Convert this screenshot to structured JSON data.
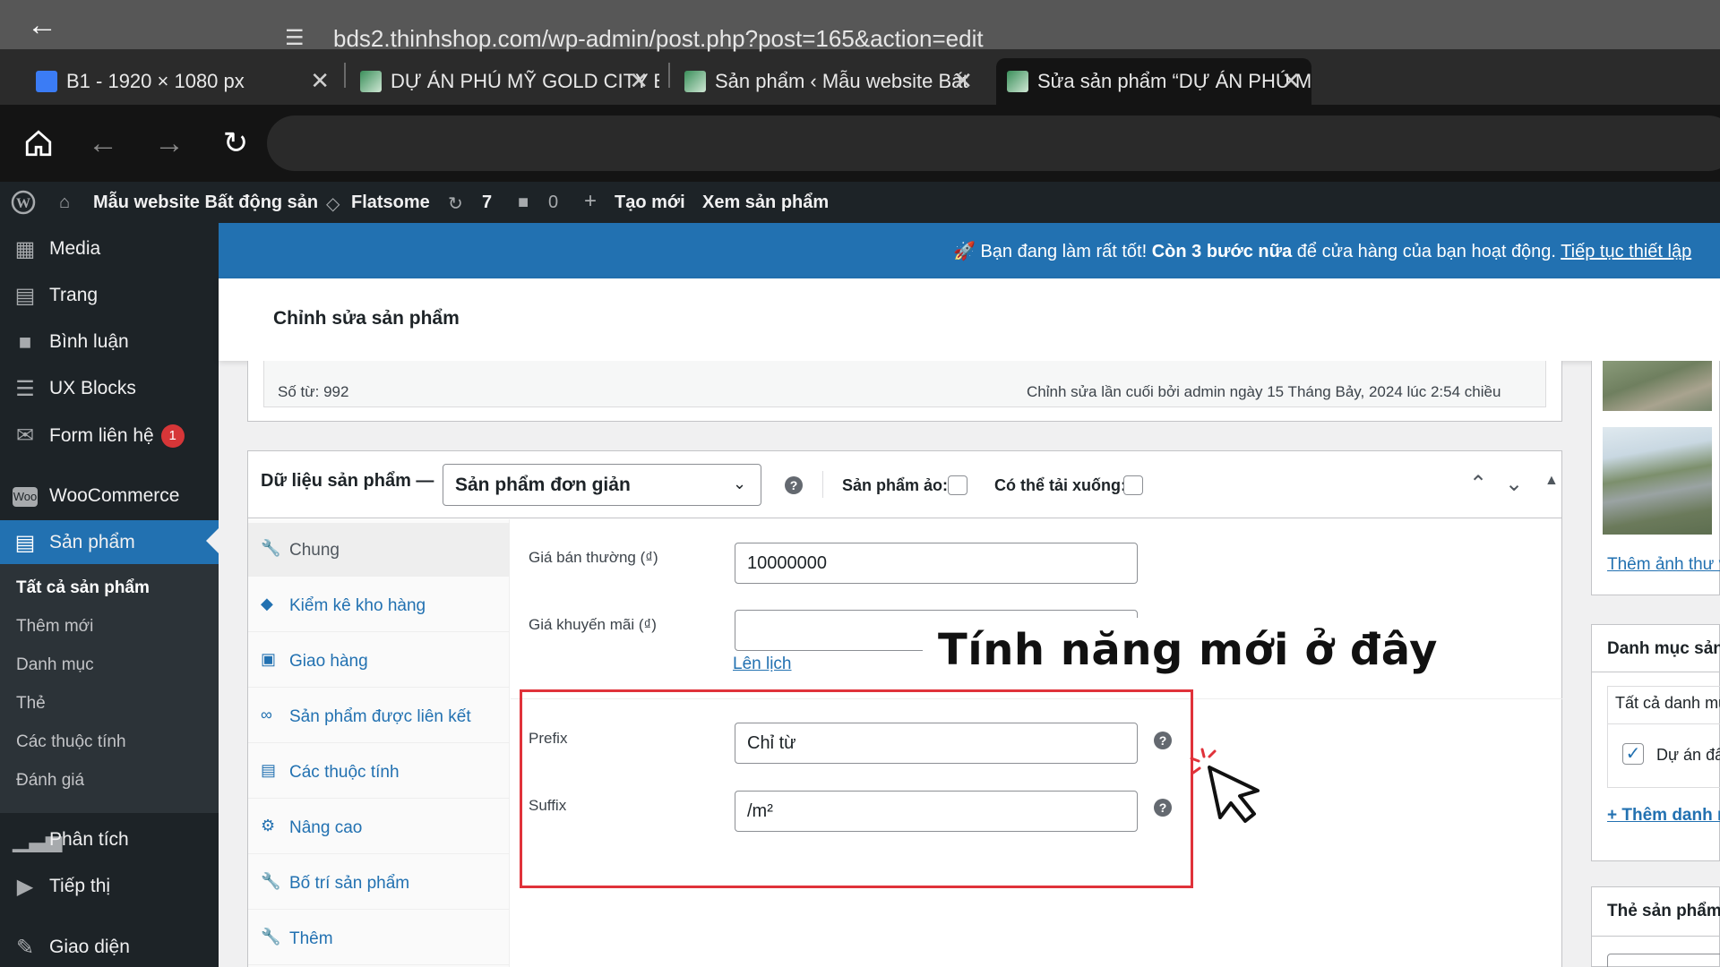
{
  "browser": {
    "tabs": [
      {
        "title": "B1 - 1920 × 1080 px",
        "favicon": "canva-icon",
        "color": "#3b7cf5"
      },
      {
        "title": "DỰ ÁN PHÚ MỸ GOLD CITY BÀ",
        "favicon": "site-icon",
        "color": "#3a8f5a"
      },
      {
        "title": "Sản phẩm ‹ Mẫu website Bất",
        "favicon": "site-icon",
        "color": "#3a8f5a"
      },
      {
        "title": "Sửa sản phẩm “DỰ ÁN PHÚ MỸ",
        "favicon": "site-icon",
        "color": "#3a8f5a"
      }
    ],
    "url": "bds2.thinhshop.com/wp-admin/post.php?post=165&action=edit"
  },
  "adminbar": {
    "site": "Mẫu website Bất động sản",
    "theme": "Flatsome",
    "updates": "7",
    "comments": "0",
    "new": "Tạo mới",
    "view": "Xem sản phẩm"
  },
  "sidebar": {
    "items": [
      {
        "label": "Media",
        "icon": "media-icon"
      },
      {
        "label": "Trang",
        "icon": "page-icon"
      },
      {
        "label": "Bình luận",
        "icon": "comment-icon"
      },
      {
        "label": "UX Blocks",
        "icon": "blocks-icon"
      },
      {
        "label": "Form liên hệ",
        "icon": "mail-icon",
        "badge": "1"
      },
      {
        "label": "WooCommerce",
        "icon": "woo-icon"
      },
      {
        "label": "Sản phẩm",
        "icon": "product-icon"
      },
      {
        "label": "Phân tích",
        "icon": "chart-icon"
      },
      {
        "label": "Tiếp thị",
        "icon": "megaphone-icon"
      },
      {
        "label": "Giao diện",
        "icon": "brush-icon"
      }
    ],
    "submenu": [
      "Tất cả sản phẩm",
      "Thêm mới",
      "Danh mục",
      "Thẻ",
      "Các thuộc tính",
      "Đánh giá"
    ]
  },
  "notice": {
    "lead": "Bạn đang làm rất tốt! ",
    "bold": "Còn 3 bước nữa",
    "rest": " để cửa hàng của bạn hoạt động. ",
    "link": "Tiếp tục thiết lập"
  },
  "page": {
    "title": "Chỉnh sửa sản phẩm",
    "word_count": "Số từ: 992",
    "last_edit": "Chỉnh sửa lần cuối bởi admin ngày 15 Tháng Bảy, 2024 lúc 2:54 chiều"
  },
  "product_data": {
    "label": "Dữ liệu sản phẩm —",
    "type": "Sản phẩm đơn giản",
    "virtual_label": "Sản phẩm ảo:",
    "download_label": "Có thể tải xuống:",
    "tabs": [
      {
        "label": "Chung",
        "icon": "wrench-icon"
      },
      {
        "label": "Kiểm kê kho hàng",
        "icon": "tag-icon"
      },
      {
        "label": "Giao hàng",
        "icon": "truck-icon"
      },
      {
        "label": "Sản phẩm được liên kết",
        "icon": "link-icon"
      },
      {
        "label": "Các thuộc tính",
        "icon": "list-icon"
      },
      {
        "label": "Nâng cao",
        "icon": "gear-icon"
      },
      {
        "label": "Bố trí sản phẩm",
        "icon": "wrench-icon"
      },
      {
        "label": "Thêm",
        "icon": "wrench-icon"
      }
    ],
    "regular_price_label": "Giá bán thường (₫)",
    "regular_price": "10000000",
    "sale_price_label": "Giá khuyến mãi (₫)",
    "sale_price": "",
    "schedule": "Lên lịch",
    "prefix_label": "Prefix",
    "prefix": "Chỉ từ",
    "suffix_label": "Suffix",
    "suffix": "/m²"
  },
  "overlay": {
    "caption": "Tính năng mới ở đây",
    "highlight_color": "#e0323a"
  },
  "right": {
    "add_image": "Thêm ảnh thư viện",
    "category_title": "Danh mục sản phẩm",
    "all_categories": "Tất cả danh mục",
    "category_item": "Dự án đất nền",
    "add_category": "+ Thêm danh mục",
    "tags_title": "Thẻ sản phẩm"
  }
}
